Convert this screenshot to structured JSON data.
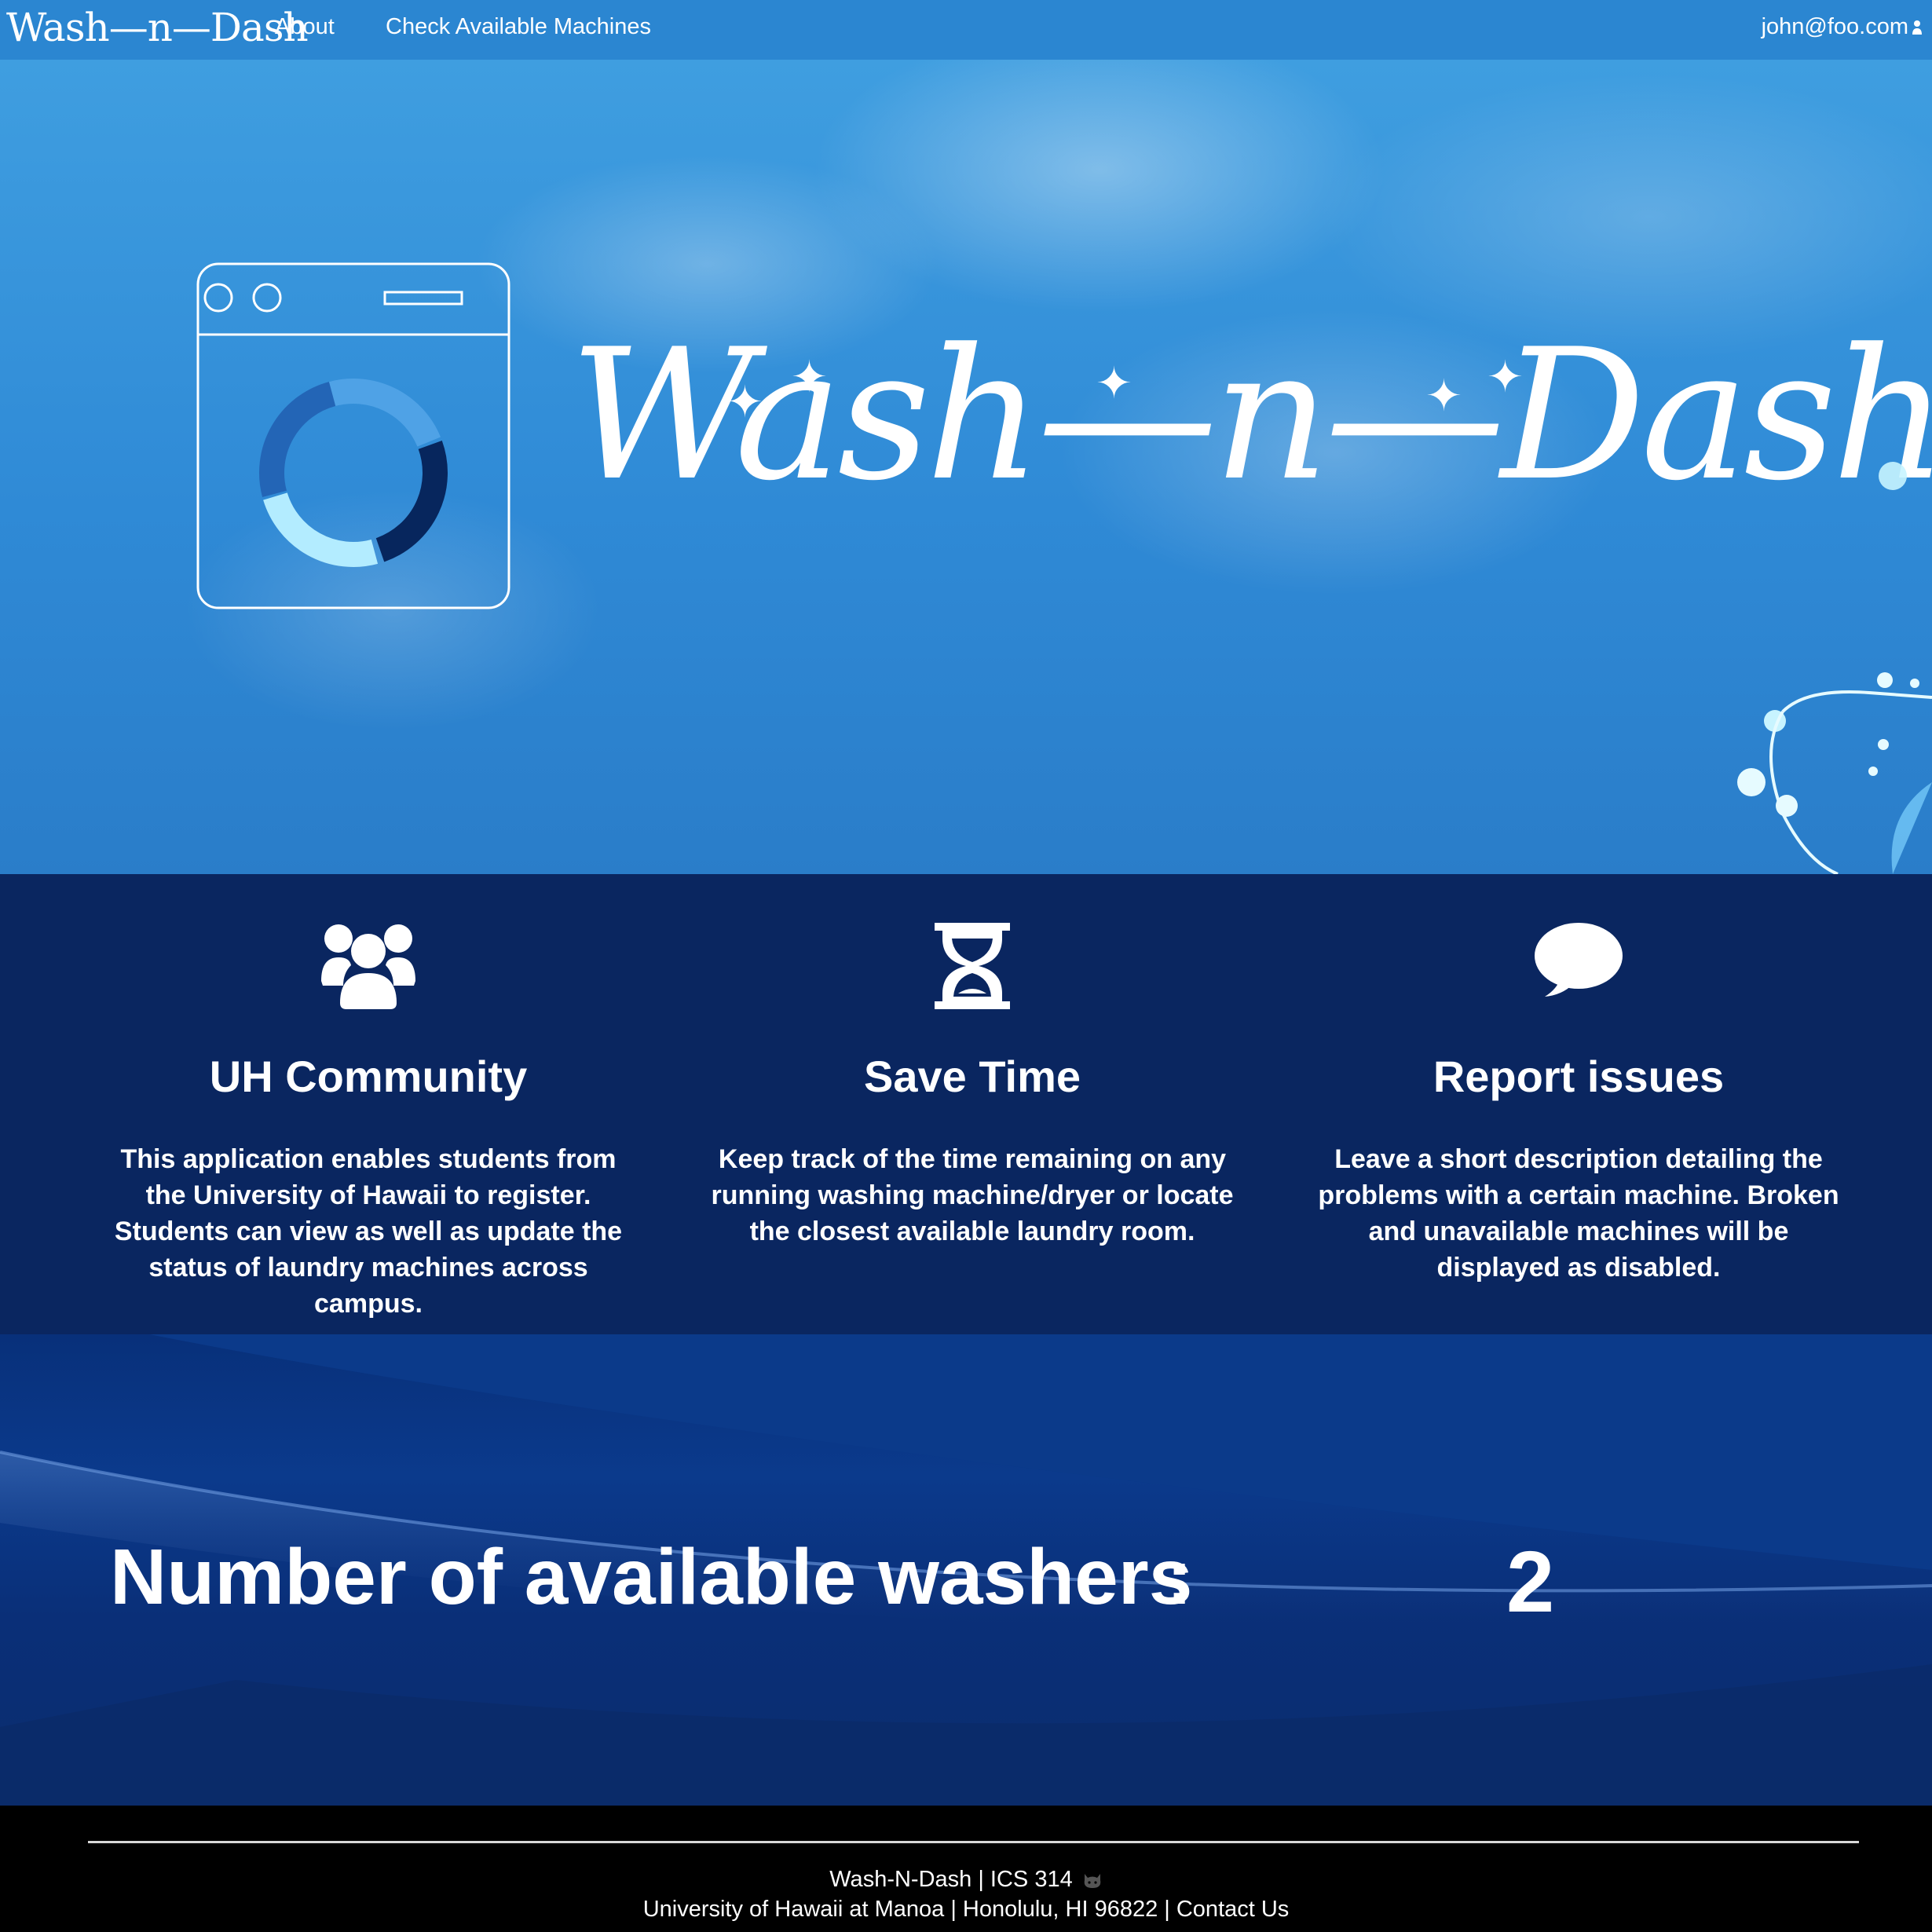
{
  "navbar": {
    "brand": "Wash—n—Dash",
    "links": [
      {
        "label": "About"
      },
      {
        "label": "Check Available Machines"
      }
    ],
    "user": "john@foo.com"
  },
  "hero": {
    "title": "Wash—n—Dash",
    "logo_icon": "washing-machine-icon"
  },
  "features": [
    {
      "icon": "users-icon",
      "title": "UH Community",
      "text": "This application enables students from the University of Hawaii to register.  Students can view as well as update the status of laundry machines across campus."
    },
    {
      "icon": "hourglass-icon",
      "title": "Save Time",
      "text": "Keep track of the time remaining on any running washing machine/dryer or locate the closest available laundry room."
    },
    {
      "icon": "comment-icon",
      "title": "Report issues",
      "text": "Leave a short description detailing the problems with a certain machine.   Broken and unavailable machines will be displayed as disabled."
    }
  ],
  "availability": {
    "label": "Number of available washers",
    "separator": ":",
    "count": "2"
  },
  "footer": {
    "line1": "Wash-N-Dash | ICS 314",
    "line2": "University of Hawaii at Manoa | Honolulu, HI 96822 | Contact Us"
  },
  "colors": {
    "navbar": "#2b86d1",
    "features_bg": "#0a2660",
    "footer_bg": "#000000",
    "accent_light": "#b3ecff"
  }
}
